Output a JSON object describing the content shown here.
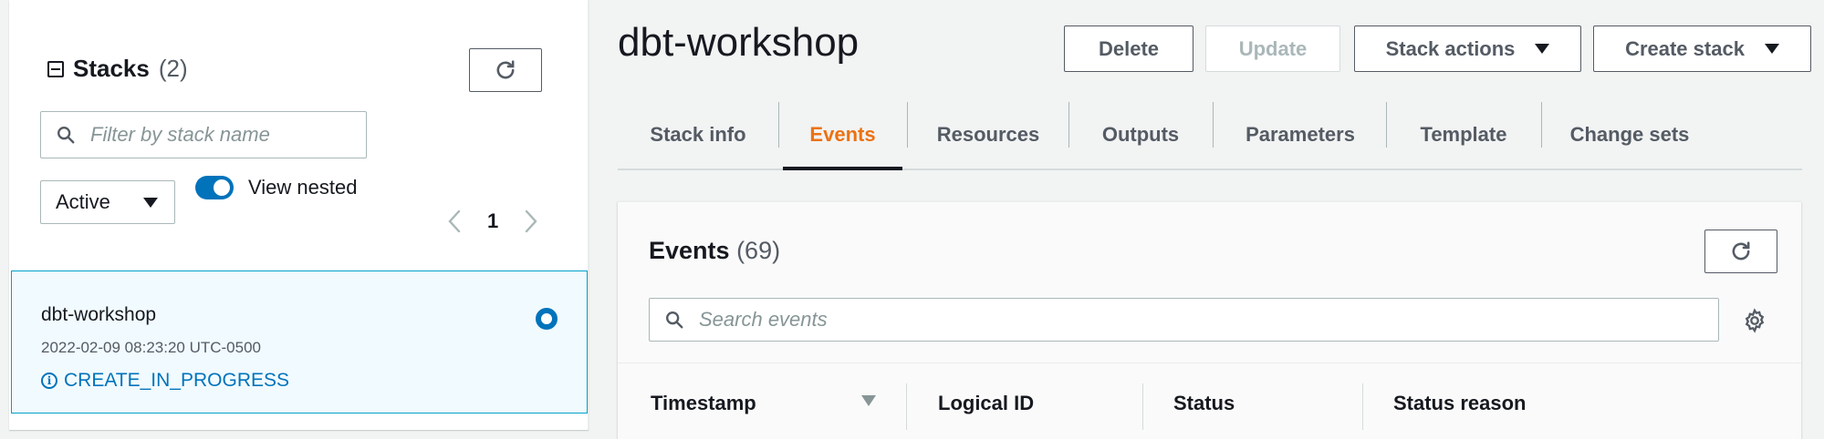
{
  "stacks_panel": {
    "title": "Stacks",
    "count": "(2)",
    "search_placeholder": "Filter by stack name",
    "status_filter": "Active",
    "view_nested_label": "View nested",
    "view_nested_on": true,
    "page": "1",
    "stacks": [
      {
        "name": "dbt-workshop",
        "created": "2022-02-09 08:23:20 UTC-0500",
        "status": "CREATE_IN_PROGRESS",
        "selected": true
      }
    ]
  },
  "stack_detail": {
    "title": "dbt-workshop",
    "buttons": {
      "delete": "Delete",
      "update": "Update",
      "stack_actions": "Stack actions",
      "create_stack": "Create stack"
    },
    "tabs": [
      "Stack info",
      "Events",
      "Resources",
      "Outputs",
      "Parameters",
      "Template",
      "Change sets"
    ],
    "active_tab": "Events"
  },
  "events": {
    "title": "Events",
    "count": "(69)",
    "search_placeholder": "Search events",
    "columns": [
      "Timestamp",
      "Logical ID",
      "Status",
      "Status reason"
    ]
  },
  "colors": {
    "accent": "#0073bb",
    "active_tab": "#ec7211",
    "selected_bg": "#f1faff"
  }
}
